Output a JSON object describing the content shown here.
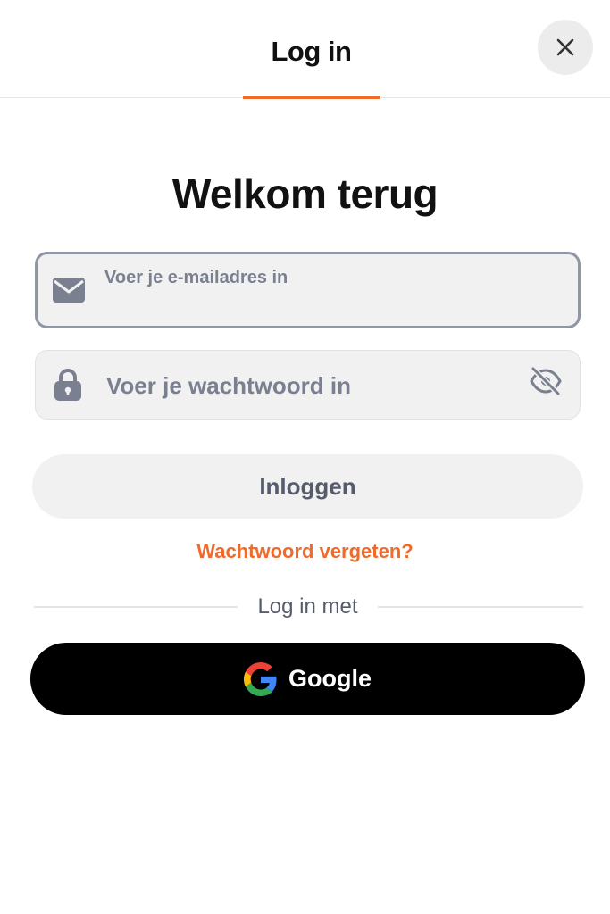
{
  "header": {
    "tab_label": "Log in",
    "close_icon": "close-icon"
  },
  "title": "Welkom terug",
  "email": {
    "placeholder": "Voer je e-mailadres in",
    "value": "",
    "icon": "envelope-icon"
  },
  "password": {
    "placeholder": "Voer je wachtwoord in",
    "value": "",
    "icon": "lock-icon",
    "toggle_icon": "eye-off-icon"
  },
  "login_button": "Inloggen",
  "forgot_password": "Wachtwoord vergeten?",
  "divider_text": "Log in met",
  "google_button": {
    "label": "Google",
    "icon": "google-icon"
  },
  "colors": {
    "accent": "#f06a2a",
    "input_bg": "#f1f1f1",
    "input_border_focus": "#8f96a6",
    "google_bg": "#000000"
  }
}
